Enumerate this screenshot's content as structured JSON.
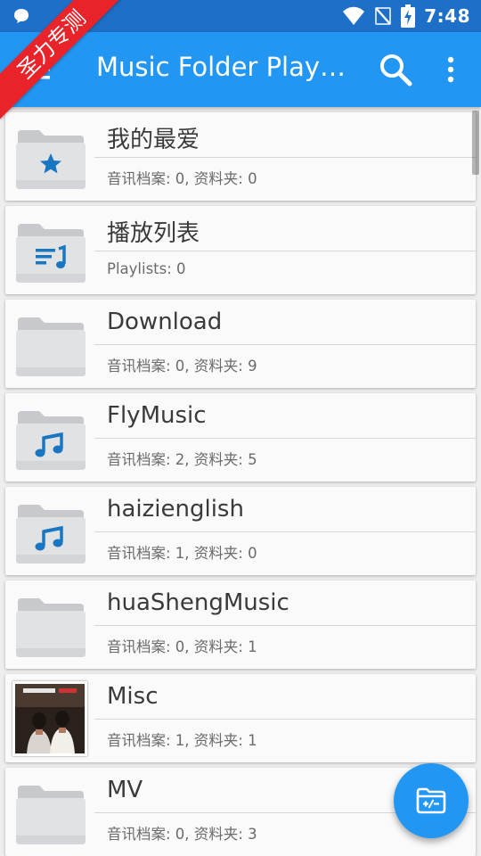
{
  "watermark": {
    "text": "圣力专测"
  },
  "status_bar": {
    "time": "7:48",
    "icons": [
      "notification-bubble-icon",
      "wifi-icon",
      "no-signal-icon",
      "battery-charging-icon"
    ]
  },
  "app_bar": {
    "title": "Music Folder Player Free",
    "icons": [
      "menu-icon",
      "search-icon",
      "more-vert-icon"
    ]
  },
  "folders": [
    {
      "name": "我的最爱",
      "info": "音讯档案: 0, 资料夹: 0",
      "icon": "folder-star-icon"
    },
    {
      "name": "播放列表",
      "info": "Playlists: 0",
      "icon": "folder-playlist-icon"
    },
    {
      "name": "Download",
      "info": "音讯档案: 0, 资料夹: 9",
      "icon": "folder-icon"
    },
    {
      "name": "FlyMusic",
      "info": "音讯档案: 2, 资料夹: 5",
      "icon": "folder-music-icon"
    },
    {
      "name": "haizienglish",
      "info": "音讯档案: 1, 资料夹: 0",
      "icon": "folder-music-icon"
    },
    {
      "name": "huaShengMusic",
      "info": "音讯档案: 0, 资料夹: 1",
      "icon": "folder-icon"
    },
    {
      "name": "Misc",
      "info": "音讯档案: 1, 资料夹: 1",
      "icon": "album-art-thumbnail"
    },
    {
      "name": "MV",
      "info": "音讯档案: 0, 资料夹: 3",
      "icon": "folder-icon"
    }
  ],
  "fab": {
    "icon": "folder-add-remove-icon"
  },
  "colors": {
    "status_bar": "#1e6fc7",
    "app_bar": "#2196f3",
    "accent_icon": "#1976c2",
    "ribbon": "#e8242a",
    "background": "#eeeeee"
  }
}
